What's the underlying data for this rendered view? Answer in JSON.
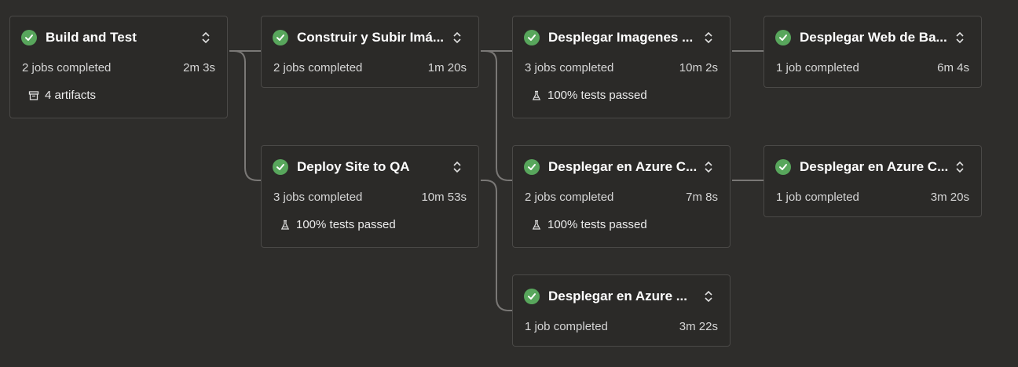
{
  "stages": [
    {
      "title": "Build and Test",
      "jobs": "2 jobs completed",
      "duration": "2m 3s",
      "extra": "4 artifacts",
      "extra_icon": "artifact-icon"
    },
    {
      "title": "Construir y Subir Imá...",
      "jobs": "2 jobs completed",
      "duration": "1m 20s"
    },
    {
      "title": "Desplegar Imagenes ...",
      "jobs": "3 jobs completed",
      "duration": "10m 2s",
      "extra": "100% tests passed",
      "extra_icon": "flask-icon"
    },
    {
      "title": "Desplegar Web de Ba...",
      "jobs": "1 job completed",
      "duration": "6m 4s"
    },
    {
      "title": "Deploy Site to QA",
      "jobs": "3 jobs completed",
      "duration": "10m 53s",
      "extra": "100% tests passed",
      "extra_icon": "flask-icon"
    },
    {
      "title": "Desplegar en Azure C...",
      "jobs": "2 jobs completed",
      "duration": "7m 8s",
      "extra": "100% tests passed",
      "extra_icon": "flask-icon"
    },
    {
      "title": "Desplegar en Azure C...",
      "jobs": "1 job completed",
      "duration": "3m 20s"
    },
    {
      "title": "Desplegar en Azure ...",
      "jobs": "1 job completed",
      "duration": "3m 22s"
    }
  ],
  "colors": {
    "success": "#58a65c",
    "background": "#2e2d2b",
    "card": "#2b2a28",
    "border": "#4a4947",
    "connector": "#7a7876"
  }
}
